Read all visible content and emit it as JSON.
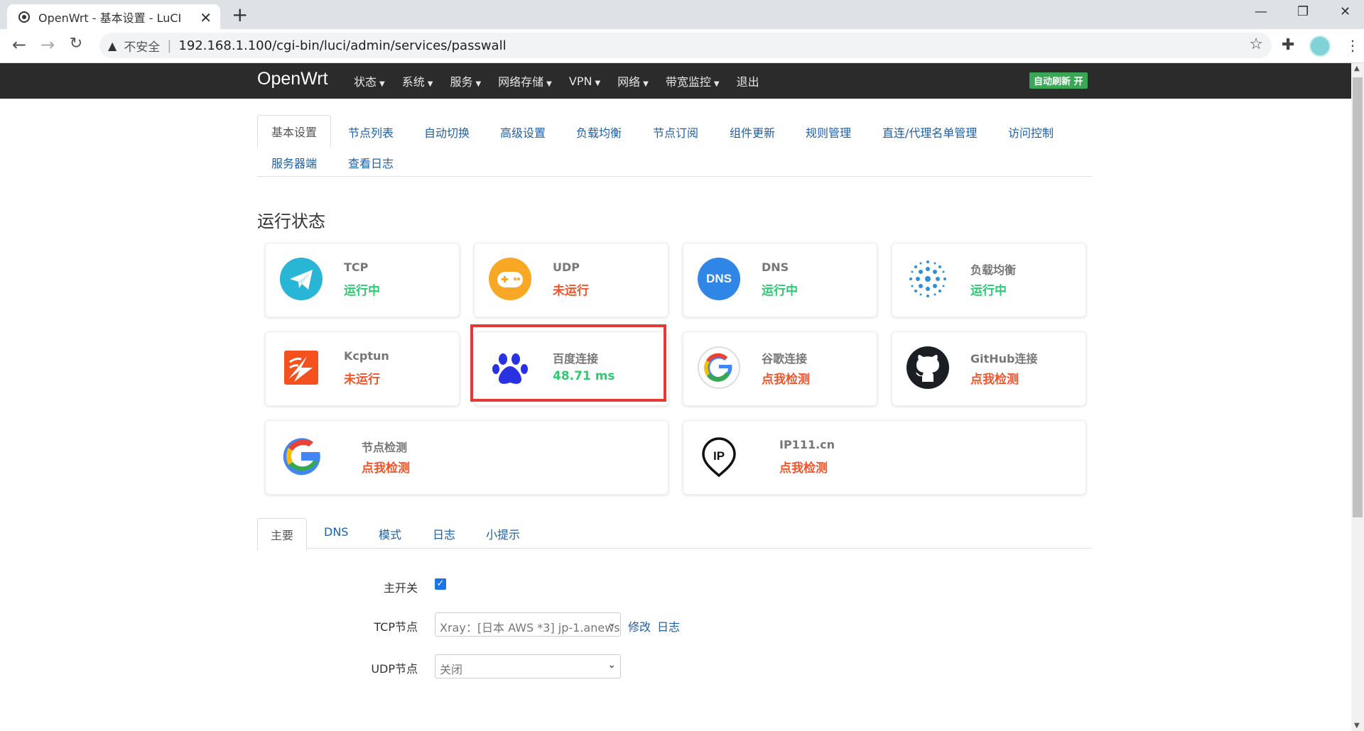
{
  "browser": {
    "tab_title": "OpenWrt - 基本设置 - LuCI",
    "tab_close": "✕",
    "new_tab": "+",
    "security_label": "不安全",
    "separator": "|",
    "url": "192.168.1.100/cgi-bin/luci/admin/services/passwall",
    "window_controls": [
      "—",
      "❐",
      "✕"
    ],
    "nav_icons": [
      "arrow-left-icon",
      "arrow-right-icon",
      "reload-icon"
    ]
  },
  "header": {
    "brand": "OpenWrt",
    "menu": [
      {
        "label": "状态",
        "caret": true
      },
      {
        "label": "系统",
        "caret": true
      },
      {
        "label": "服务",
        "caret": true
      },
      {
        "label": "网络存储",
        "caret": true
      },
      {
        "label": "VPN",
        "caret": true
      },
      {
        "label": "网络",
        "caret": true
      },
      {
        "label": "带宽监控",
        "caret": true
      },
      {
        "label": "退出",
        "caret": false
      }
    ],
    "auto_refresh": "自动刷新 开"
  },
  "subtabs": {
    "row1": [
      "基本设置",
      "节点列表",
      "自动切换",
      "高级设置",
      "负载均衡",
      "节点订阅",
      "组件更新",
      "规则管理",
      "直连/代理名单管理",
      "访问控制"
    ],
    "row2": [
      "服务器端",
      "查看日志"
    ],
    "active": "基本设置"
  },
  "section_title": "运行状态",
  "cards": {
    "tcp": {
      "label": "TCP",
      "status": "运行中"
    },
    "udp": {
      "label": "UDP",
      "status": "未运行"
    },
    "dns": {
      "label": "DNS",
      "status": "运行中",
      "icon_text": "DNS"
    },
    "lb": {
      "label": "负载均衡",
      "status": "运行中"
    },
    "kcptun": {
      "label": "Kcptun",
      "status": "未运行"
    },
    "baidu": {
      "label": "百度连接",
      "status": "48.71 ms"
    },
    "google": {
      "label": "谷歌连接",
      "status": "点我检测"
    },
    "github": {
      "label": "GitHub连接",
      "status": "点我检测"
    },
    "nodecheck": {
      "label": "节点检测",
      "status": "点我检测"
    },
    "ip111": {
      "label": "IP111.cn",
      "status": "点我检测",
      "icon_text": "IP"
    }
  },
  "bottom_tabs": [
    "主要",
    "DNS",
    "模式",
    "日志",
    "小提示"
  ],
  "form": {
    "main_switch_label": "主开关",
    "tcp_node_label": "TCP节点",
    "tcp_node_value": "Xray：[日本 AWS *3] jp-1.anews",
    "tcp_edit": "修改",
    "tcp_log": "日志",
    "udp_node_label": "UDP节点",
    "udp_node_value": "关闭"
  },
  "colors": {
    "running": "#2ecc71",
    "stopped": "#f0542a",
    "link": "#1e5fa8",
    "header_bg": "#2b2b2b",
    "badge_green": "#3aa757",
    "highlight_red": "#e53935"
  }
}
